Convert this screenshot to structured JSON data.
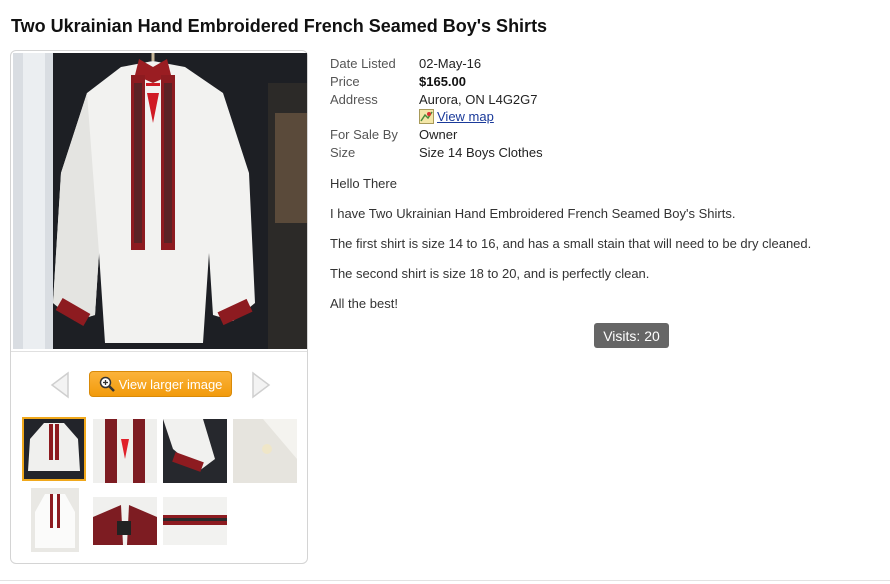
{
  "page_title": "Two Ukrainian Hand Embroidered French Seamed Boy's Shirts",
  "details": {
    "date_listed_label": "Date Listed",
    "date_listed": "02-May-16",
    "price_label": "Price",
    "price": "$165.00",
    "address_label": "Address",
    "address": "Aurora, ON L4G2G7",
    "view_map": "View map",
    "for_sale_by_label": "For Sale By",
    "for_sale_by": "Owner",
    "size_label": "Size",
    "size": "Size 14 Boys Clothes"
  },
  "description": [
    "Hello There",
    "I have Two Ukrainian Hand Embroidered French Seamed Boy's Shirts.",
    "The first shirt is size 14 to 16, and has a small stain that will need to be dry cleaned.",
    "The second shirt is size 18 to 20, and is perfectly clean.",
    "All the best!"
  ],
  "visits": "Visits: 20",
  "gallery": {
    "view_larger": "View larger image",
    "thumbnail_count": 7,
    "selected_index": 0
  },
  "colors": {
    "accent_orange": "#f29b0c",
    "thumb_selected_border": "#f0a81c",
    "link_blue": "#1a3a9a",
    "visits_badge": "#666666",
    "embroidery_red": "#b0171f"
  }
}
